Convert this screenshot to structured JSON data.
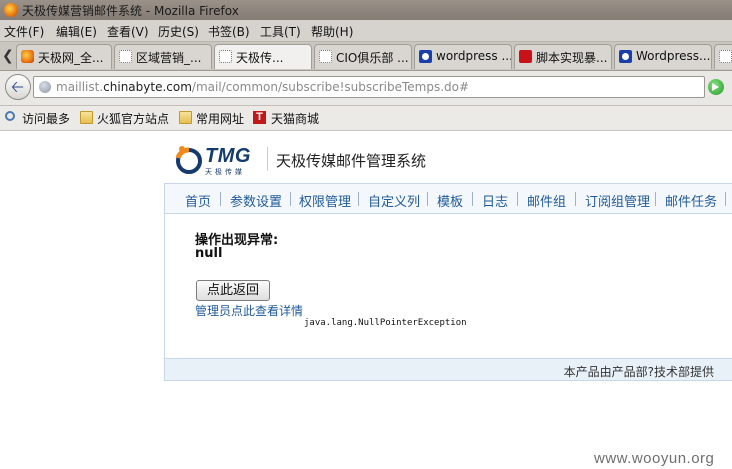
{
  "window": {
    "title": "天极传媒营销邮件系统 - Mozilla Firefox"
  },
  "menubar": {
    "items": [
      {
        "label": "文件(F)"
      },
      {
        "label": "编辑(E)"
      },
      {
        "label": "查看(V)"
      },
      {
        "label": "历史(S)"
      },
      {
        "label": "书签(B)"
      },
      {
        "label": "工具(T)"
      },
      {
        "label": "帮助(H)"
      }
    ]
  },
  "tabs": [
    {
      "label": "天极网_全...",
      "icon": "firefox-icon",
      "active": false
    },
    {
      "label": "区域营销_...",
      "icon": "blank-page-icon",
      "active": false
    },
    {
      "label": "天极传...",
      "icon": "blank-page-icon",
      "active": true
    },
    {
      "label": "CIO俱乐部 ...",
      "icon": "blank-page-icon",
      "active": false
    },
    {
      "label": "wordpress ...",
      "icon": "paw-icon",
      "active": false
    },
    {
      "label": "脚本实现暴...",
      "icon": "red-hat-icon",
      "active": false
    },
    {
      "label": "Wordpress...",
      "icon": "paw-icon",
      "active": false
    }
  ],
  "address": {
    "prefix": "maillist.",
    "domain": "chinabyte.com",
    "path": "/mail/common/subscribe!subscribeTemps.do#"
  },
  "bookmarks": [
    {
      "label": "访问最多",
      "icon": "search-icon"
    },
    {
      "label": "火狐官方站点",
      "icon": "folder-icon"
    },
    {
      "label": "常用网址",
      "icon": "folder-icon"
    },
    {
      "label": "天猫商城",
      "icon": "tmall-icon"
    }
  ],
  "page": {
    "logo_text": "TMG",
    "logo_sub": "天极传媒",
    "system_title": "天极传媒邮件管理系统",
    "nav": [
      {
        "label": "首页"
      },
      {
        "label": "参数设置"
      },
      {
        "label": "权限管理"
      },
      {
        "label": "自定义列"
      },
      {
        "label": "模板"
      },
      {
        "label": "日志"
      },
      {
        "label": "邮件组"
      },
      {
        "label": "订阅组管理"
      },
      {
        "label": "邮件任务"
      }
    ],
    "error_title": "操作出现异常:",
    "error_message": "null",
    "back_button": "点此返回",
    "admin_link": "管理员点此查看详情",
    "exception": "java.lang.NullPointerException",
    "footer": "本产品由产品部?技术部提供"
  },
  "watermark": "www.wooyun.org",
  "colors": {
    "link_blue": "#1f5a98",
    "nav_panel_bg": "#f4f8fc",
    "footer_bg": "#e9f1f8",
    "logo_navy": "#143a6e",
    "logo_orange": "#f08a1c"
  }
}
